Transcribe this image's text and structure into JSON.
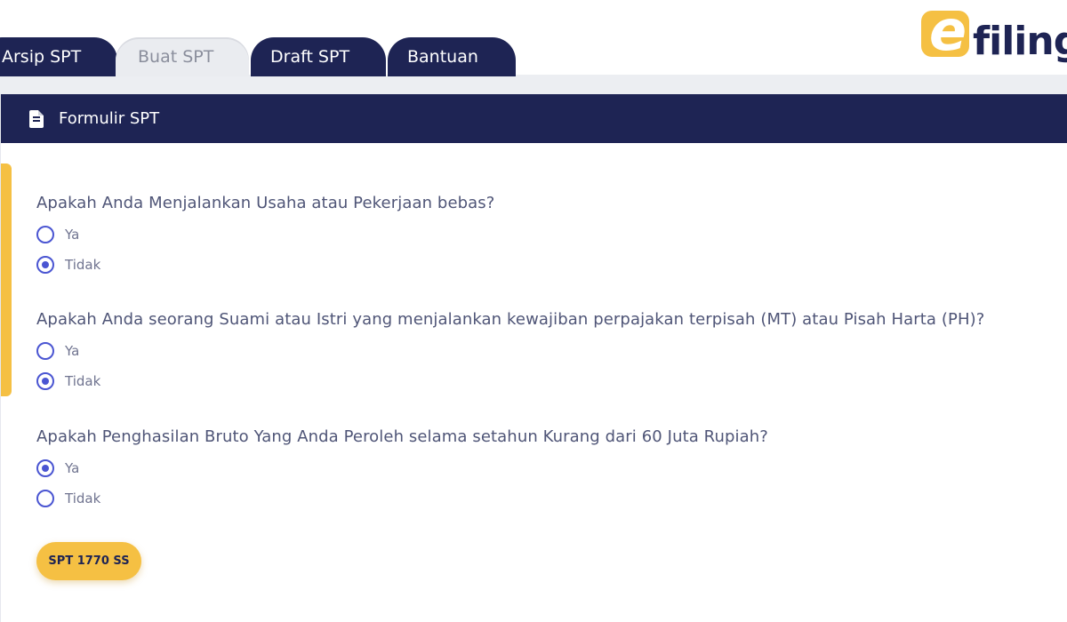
{
  "tabs": [
    {
      "label": "Arsip SPT",
      "active": false
    },
    {
      "label": "Buat SPT",
      "active": true
    },
    {
      "label": "Draft SPT",
      "active": false
    },
    {
      "label": "Bantuan",
      "active": false
    }
  ],
  "logo": {
    "mark": "e",
    "text": "filing"
  },
  "panel": {
    "title": "Formulir SPT",
    "icon": "document-icon"
  },
  "questions": [
    {
      "label": "Apakah Anda Menjalankan Usaha atau Pekerjaan bebas?",
      "options": [
        "Ya",
        "Tidak"
      ],
      "selected": "Tidak"
    },
    {
      "label": "Apakah Anda seorang Suami atau Istri yang menjalankan kewajiban perpajakan terpisah (MT) atau Pisah Harta (PH)?",
      "options": [
        "Ya",
        "Tidak"
      ],
      "selected": "Tidak"
    },
    {
      "label": "Apakah Penghasilan Bruto Yang Anda Peroleh selama setahun Kurang dari 60 Juta Rupiah?",
      "options": [
        "Ya",
        "Tidak"
      ],
      "selected": "Ya"
    }
  ],
  "submit": {
    "label": "SPT 1770 SS"
  },
  "colors": {
    "navy": "#1e2454",
    "accent": "#f5c043",
    "radio": "#4a55d2",
    "question_text": "#4f5577"
  }
}
